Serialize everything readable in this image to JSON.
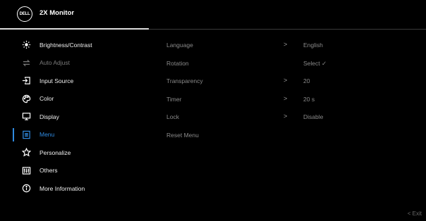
{
  "header": {
    "logo_text": "DELL",
    "title": "2X Monitor"
  },
  "menu": [
    {
      "label": "Brightness/Contrast",
      "icon": "brightness-icon",
      "state": "normal"
    },
    {
      "label": "Auto Adjust",
      "icon": "auto-adjust-icon",
      "state": "dim"
    },
    {
      "label": "Input Source",
      "icon": "input-source-icon",
      "state": "normal"
    },
    {
      "label": "Color",
      "icon": "color-palette-icon",
      "state": "normal"
    },
    {
      "label": "Display",
      "icon": "display-icon",
      "state": "normal"
    },
    {
      "label": "Menu",
      "icon": "menu-icon",
      "state": "active"
    },
    {
      "label": "Personalize",
      "icon": "star-icon",
      "state": "normal"
    },
    {
      "label": "Others",
      "icon": "others-icon",
      "state": "normal"
    },
    {
      "label": "More Information",
      "icon": "info-icon",
      "state": "normal"
    }
  ],
  "submenu": [
    {
      "label": "Language",
      "chevron": ">",
      "value": "English"
    },
    {
      "label": "Rotation",
      "chevron": "",
      "value": "Select ✓"
    },
    {
      "label": "Transparency",
      "chevron": ">",
      "value": "20"
    },
    {
      "label": "Timer",
      "chevron": ">",
      "value": "20 s"
    },
    {
      "label": "Lock",
      "chevron": ">",
      "value": "Disable"
    },
    {
      "label": "Reset Menu",
      "chevron": "",
      "value": ""
    }
  ],
  "footer": {
    "exit_label": "<  Exit"
  },
  "colors": {
    "accent": "#2f8ae0",
    "background": "#000000"
  }
}
